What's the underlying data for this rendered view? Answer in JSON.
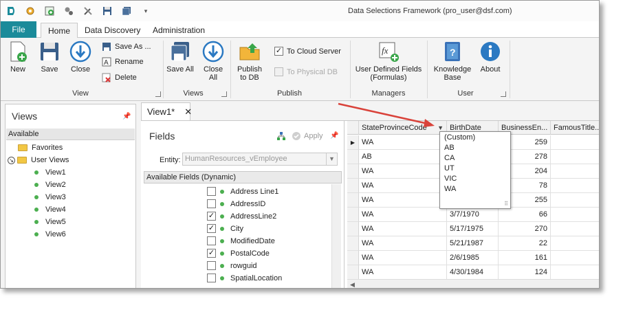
{
  "app": {
    "title": "Data Selections Framework (pro_user@dsf.com)"
  },
  "quick_access": [
    "logo-icon",
    "settings-cog-icon",
    "add-icon",
    "gears-icon",
    "tools-icon",
    "save-icon",
    "save-all-icon",
    "qat-dropdown-icon"
  ],
  "ribbon_tabs": {
    "file": "File",
    "home": "Home",
    "data_discovery": "Data Discovery",
    "administration": "Administration"
  },
  "ribbon": {
    "view_group": {
      "new": "New",
      "save": "Save",
      "close": "Close",
      "save_as": "Save As ...",
      "rename": "Rename",
      "delete": "Delete",
      "label": "View"
    },
    "views_group": {
      "save_all": "Save All",
      "close_all": "Close All",
      "label": "Views"
    },
    "publish_group": {
      "publish_to_db": "Publish to DB",
      "to_cloud": "To Cloud Server",
      "to_physical": "To Physical DB",
      "to_cloud_checked": true,
      "to_physical_checked": false,
      "label": "Publish"
    },
    "managers_group": {
      "udf": "User Defined Fields (Formulas)",
      "label": "Managers"
    },
    "user_group": {
      "knowledge_base": "Knowledge Base",
      "about": "About",
      "label": "User"
    }
  },
  "views_pane": {
    "title": "Views",
    "available": "Available",
    "favorites": "Favorites",
    "user_views": "User Views",
    "items": [
      "View1",
      "View2",
      "View3",
      "View4",
      "View5",
      "View6"
    ]
  },
  "document_tab": {
    "label": "View1*",
    "close": "✕"
  },
  "fields_pane": {
    "title": "Fields",
    "apply": "Apply",
    "entity_label": "Entity:",
    "entity_value": "HumanResources_vEmployee",
    "available_header": "Available Fields (Dynamic)",
    "fields": [
      {
        "name": "Address Line1",
        "checked": false
      },
      {
        "name": "AddressID",
        "checked": false
      },
      {
        "name": "AddressLine2",
        "checked": true
      },
      {
        "name": "City",
        "checked": true
      },
      {
        "name": "ModifiedDate",
        "checked": false
      },
      {
        "name": "PostalCode",
        "checked": true
      },
      {
        "name": "rowguid",
        "checked": false
      },
      {
        "name": "SpatialLocation",
        "checked": false
      }
    ]
  },
  "grid": {
    "columns": [
      "StateProvinceCode",
      "BirthDate",
      "BusinessEn...",
      "FamousTitle..."
    ],
    "rows": [
      {
        "state": "WA",
        "birth": "",
        "be": "259"
      },
      {
        "state": "AB",
        "birth": "",
        "be": "278"
      },
      {
        "state": "WA",
        "birth": "",
        "be": "204"
      },
      {
        "state": "WA",
        "birth": "",
        "be": "78"
      },
      {
        "state": "WA",
        "birth": "",
        "be": "255"
      },
      {
        "state": "WA",
        "birth": "3/7/1970",
        "be": "66"
      },
      {
        "state": "WA",
        "birth": "5/17/1975",
        "be": "270"
      },
      {
        "state": "WA",
        "birth": "5/21/1987",
        "be": "22"
      },
      {
        "state": "WA",
        "birth": "2/6/1985",
        "be": "161"
      },
      {
        "state": "WA",
        "birth": "4/30/1984",
        "be": "124"
      }
    ]
  },
  "filter_popup": {
    "items": [
      "(Custom)",
      "AB",
      "CA",
      "UT",
      "VIC",
      "WA"
    ]
  },
  "colors": {
    "accent": "#1b8b9a",
    "arrow": "#d9423a"
  }
}
